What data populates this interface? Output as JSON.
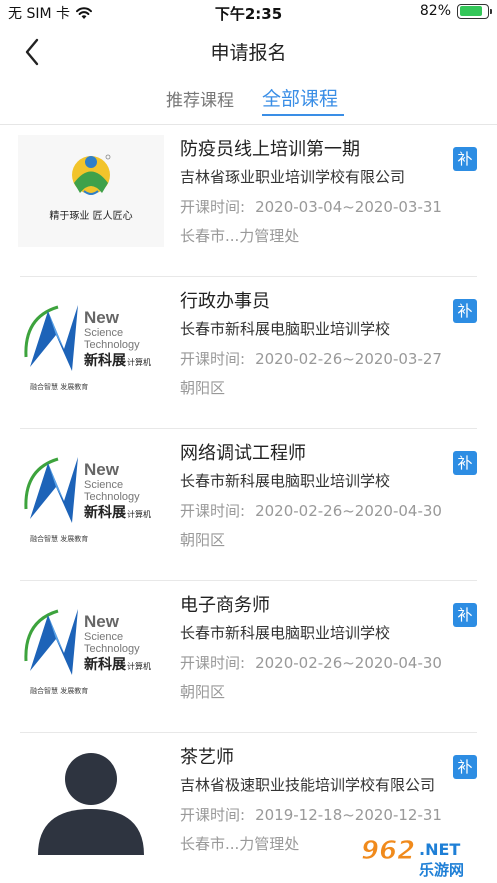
{
  "status_bar": {
    "carrier": "无 SIM 卡",
    "time": "下午2:35",
    "battery_text": "82%",
    "battery_level": 0.82,
    "battery_color": "#34c759"
  },
  "nav": {
    "title": "申请报名",
    "back_icon": "chevron-left-icon"
  },
  "tabs": [
    {
      "label": "推荐课程",
      "active": false
    },
    {
      "label": "全部课程",
      "active": true
    }
  ],
  "colors": {
    "accent": "#3a8ee6",
    "badge": "#2d8de3"
  },
  "courses": [
    {
      "title": "防疫员线上培训第一期",
      "school": "吉林省琢业职业培训学校有限公司",
      "date_label": "开课时间:",
      "date_range": "2020-03-04~2020-03-31",
      "location": "长春市...力管理处",
      "badge": "补",
      "logo": "zhuoye-logo",
      "logo_text": "精于琢业 匠人匠心"
    },
    {
      "title": "行政办事员",
      "school": "长春市新科展电脑职业培训学校",
      "date_label": "开课时间:",
      "date_range": "2020-02-26~2020-03-27",
      "location": "朝阳区",
      "badge": "补",
      "logo": "new-science-logo",
      "logo_lines": [
        "New",
        "Science",
        "Technology",
        "新科展",
        "计算机",
        "融合智慧 发展教育"
      ]
    },
    {
      "title": "网络调试工程师",
      "school": "长春市新科展电脑职业培训学校",
      "date_label": "开课时间:",
      "date_range": "2020-02-26~2020-04-30",
      "location": "朝阳区",
      "badge": "补",
      "logo": "new-science-logo",
      "logo_lines": [
        "New",
        "Science",
        "Technology",
        "新科展",
        "计算机",
        "融合智慧 发展教育"
      ]
    },
    {
      "title": "电子商务师",
      "school": "长春市新科展电脑职业培训学校",
      "date_label": "开课时间:",
      "date_range": "2020-02-26~2020-04-30",
      "location": "朝阳区",
      "badge": "补",
      "logo": "new-science-logo",
      "logo_lines": [
        "New",
        "Science",
        "Technology",
        "新科展",
        "计算机",
        "融合智慧 发展教育"
      ]
    },
    {
      "title": "茶艺师",
      "school": "吉林省极速职业技能培训学校有限公司",
      "date_label": "开课时间:",
      "date_range": "2019-12-18~2020-12-31",
      "location": "长春市...力管理处",
      "badge": "补",
      "logo": "avatar-placeholder"
    }
  ],
  "watermark": {
    "number": "962",
    "suffix": ".NET",
    "site": "乐游网"
  }
}
